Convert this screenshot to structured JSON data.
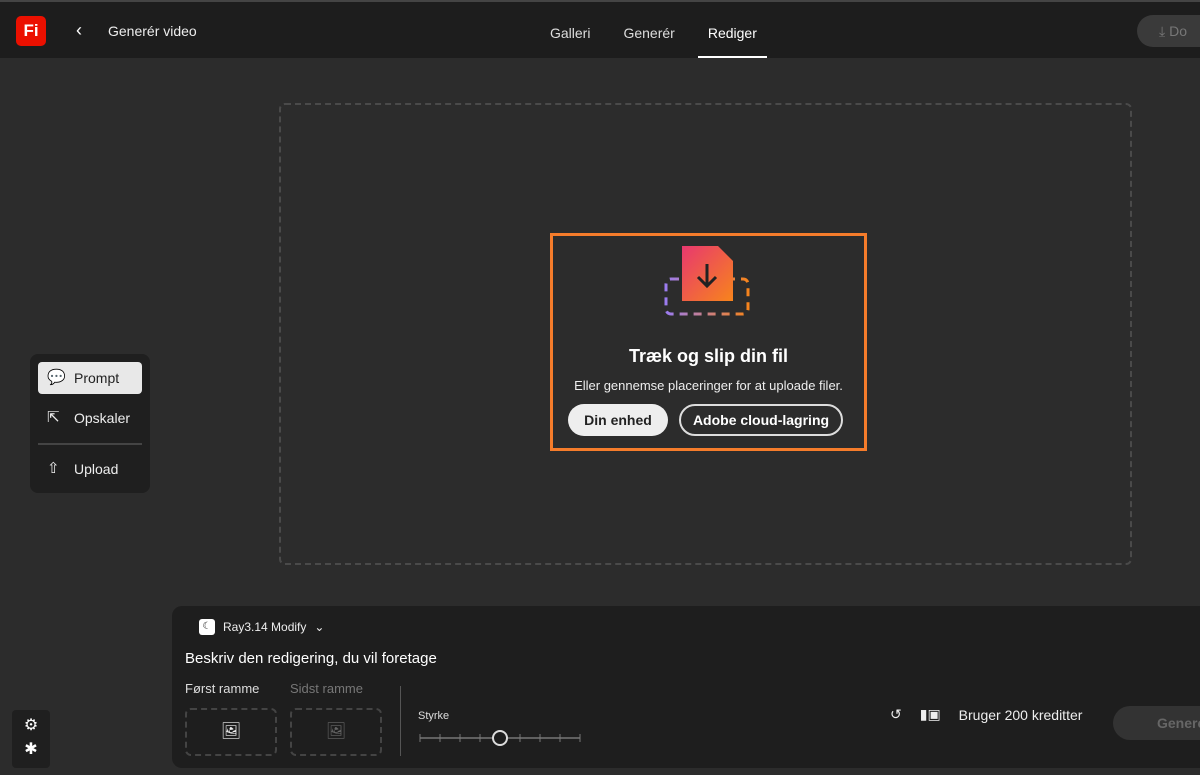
{
  "header": {
    "logo": "Fi",
    "back_icon": "chevron-left",
    "title": "Generér video",
    "tabs": [
      {
        "label": "Galleri"
      },
      {
        "label": "Generér"
      },
      {
        "label": "Rediger",
        "active": true
      }
    ],
    "download_label": "Do"
  },
  "dropzone": {
    "heading": "Træk og slip din fil",
    "subtext": "Eller gennemse placeringer for at uploade filer.",
    "device_button": "Din enhed",
    "cloud_button": "Adobe cloud-lagring",
    "highlight_color": "#f57c2b"
  },
  "sidebar": {
    "items": [
      {
        "label": "Prompt",
        "icon": "prompt-icon",
        "active": true
      },
      {
        "label": "Opskaler",
        "icon": "upscale-icon"
      },
      {
        "label": "Upload",
        "icon": "upload-icon"
      }
    ]
  },
  "bottom": {
    "model": "Ray3.14 Modify",
    "prompt_placeholder": "Beskriv den redigering, du vil foretage",
    "first_frame": "Først ramme",
    "last_frame": "Sidst ramme",
    "strength_label": "Styrke",
    "strength_value": 4,
    "strength_steps": 8,
    "credits": "Bruger 200 kreditter",
    "generate": "Generé"
  }
}
